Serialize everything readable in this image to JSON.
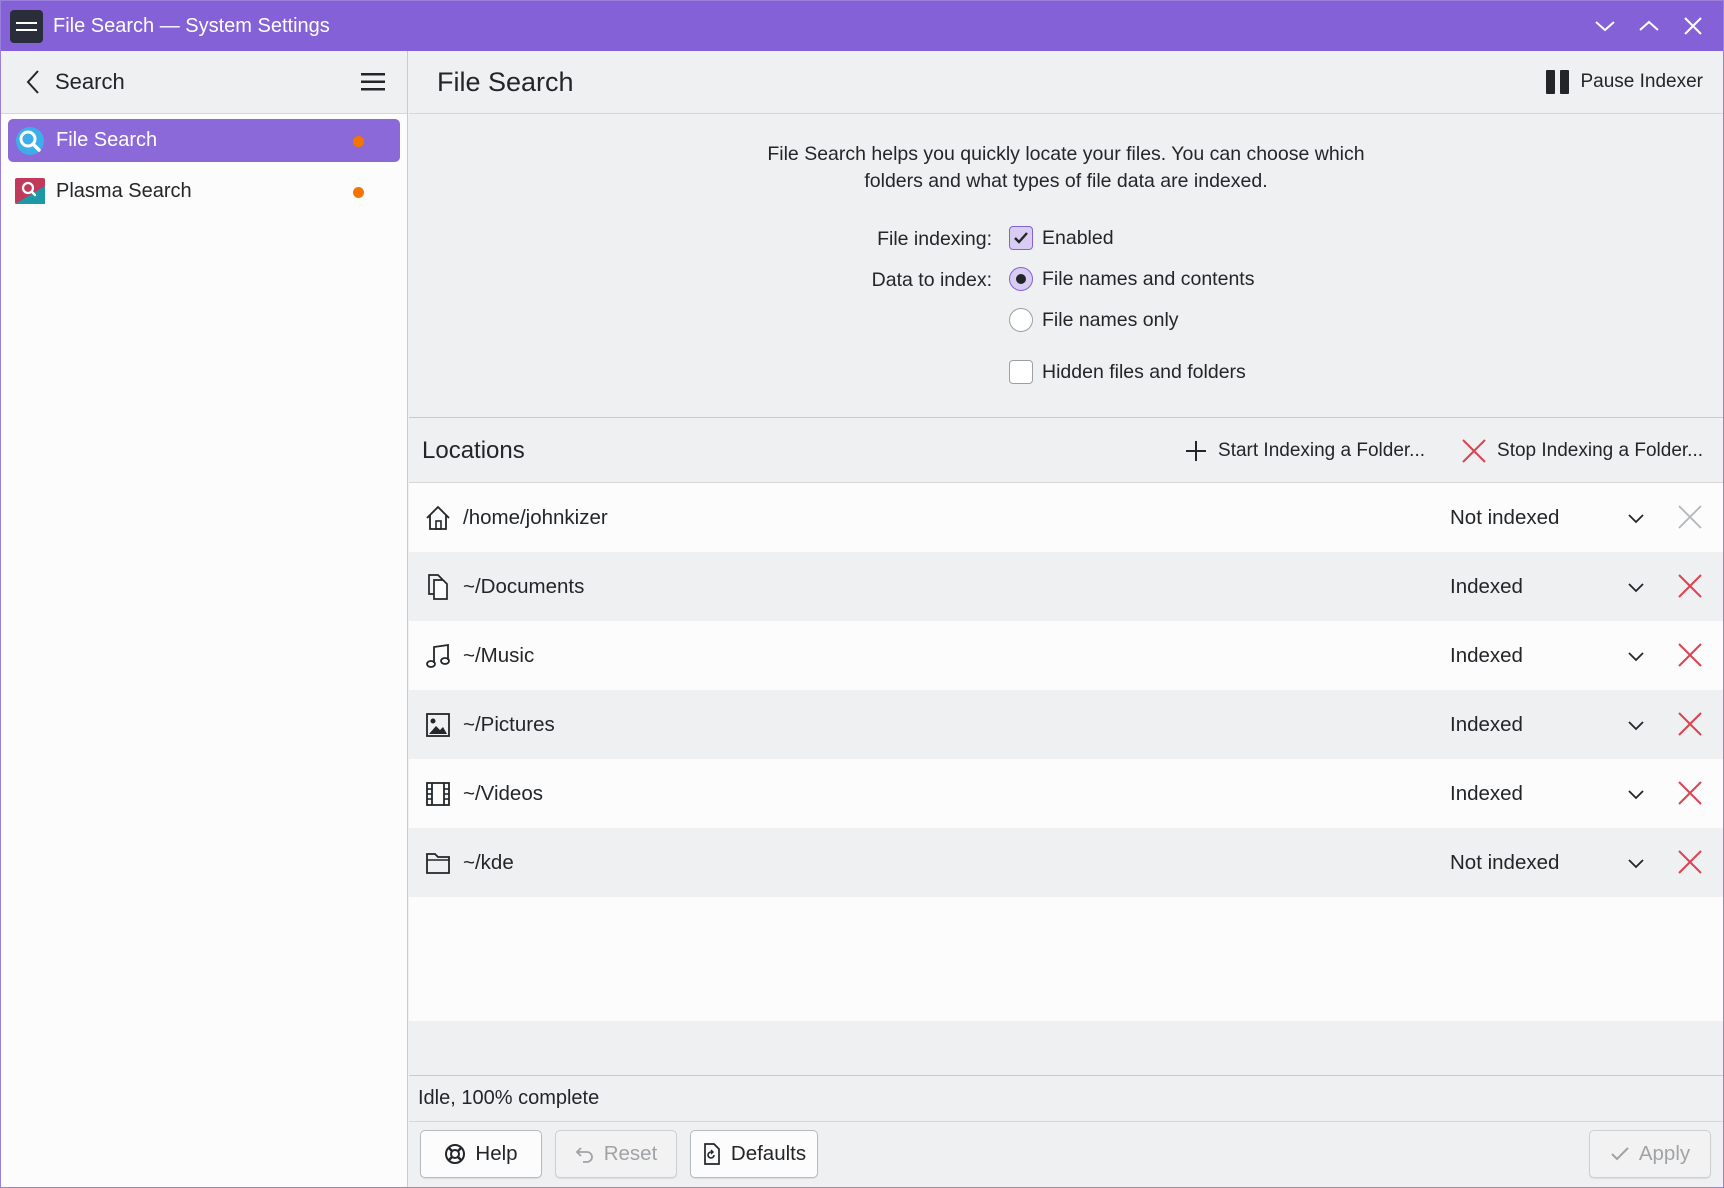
{
  "window": {
    "title": "File Search — System Settings"
  },
  "sidebar": {
    "back_label": "Search",
    "items": [
      {
        "label": "File Search",
        "active": true
      },
      {
        "label": "Plasma Search",
        "active": false
      }
    ]
  },
  "header": {
    "title": "File Search",
    "pause_label": "Pause Indexer"
  },
  "settings": {
    "description_line1": "File Search helps you quickly locate your files. You can choose which",
    "description_line2": "folders and what types of file data are indexed.",
    "file_indexing_label": "File indexing:",
    "enabled_label": "Enabled",
    "data_to_index_label": "Data to index:",
    "option_contents": "File names and contents",
    "option_names_only": "File names only",
    "hidden_files_label": "Hidden files and folders"
  },
  "locations": {
    "title": "Locations",
    "start_label": "Start Indexing a Folder...",
    "stop_label": "Stop Indexing a Folder...",
    "rows": [
      {
        "path": "/home/johnkizer",
        "status": "Not indexed",
        "icon": "home-icon"
      },
      {
        "path": "~/Documents",
        "status": "Indexed",
        "icon": "documents-icon"
      },
      {
        "path": "~/Music",
        "status": "Indexed",
        "icon": "music-icon"
      },
      {
        "path": "~/Pictures",
        "status": "Indexed",
        "icon": "pictures-icon"
      },
      {
        "path": "~/Videos",
        "status": "Indexed",
        "icon": "videos-icon"
      },
      {
        "path": "~/kde",
        "status": "Not indexed",
        "icon": "folder-icon"
      }
    ]
  },
  "status": {
    "text": "Idle, 100% complete"
  },
  "footer": {
    "help": "Help",
    "reset": "Reset",
    "defaults": "Defaults",
    "apply": "Apply"
  },
  "colors": {
    "accent": "#8461d6",
    "remove": "#da4453",
    "badge": "#f67400"
  }
}
